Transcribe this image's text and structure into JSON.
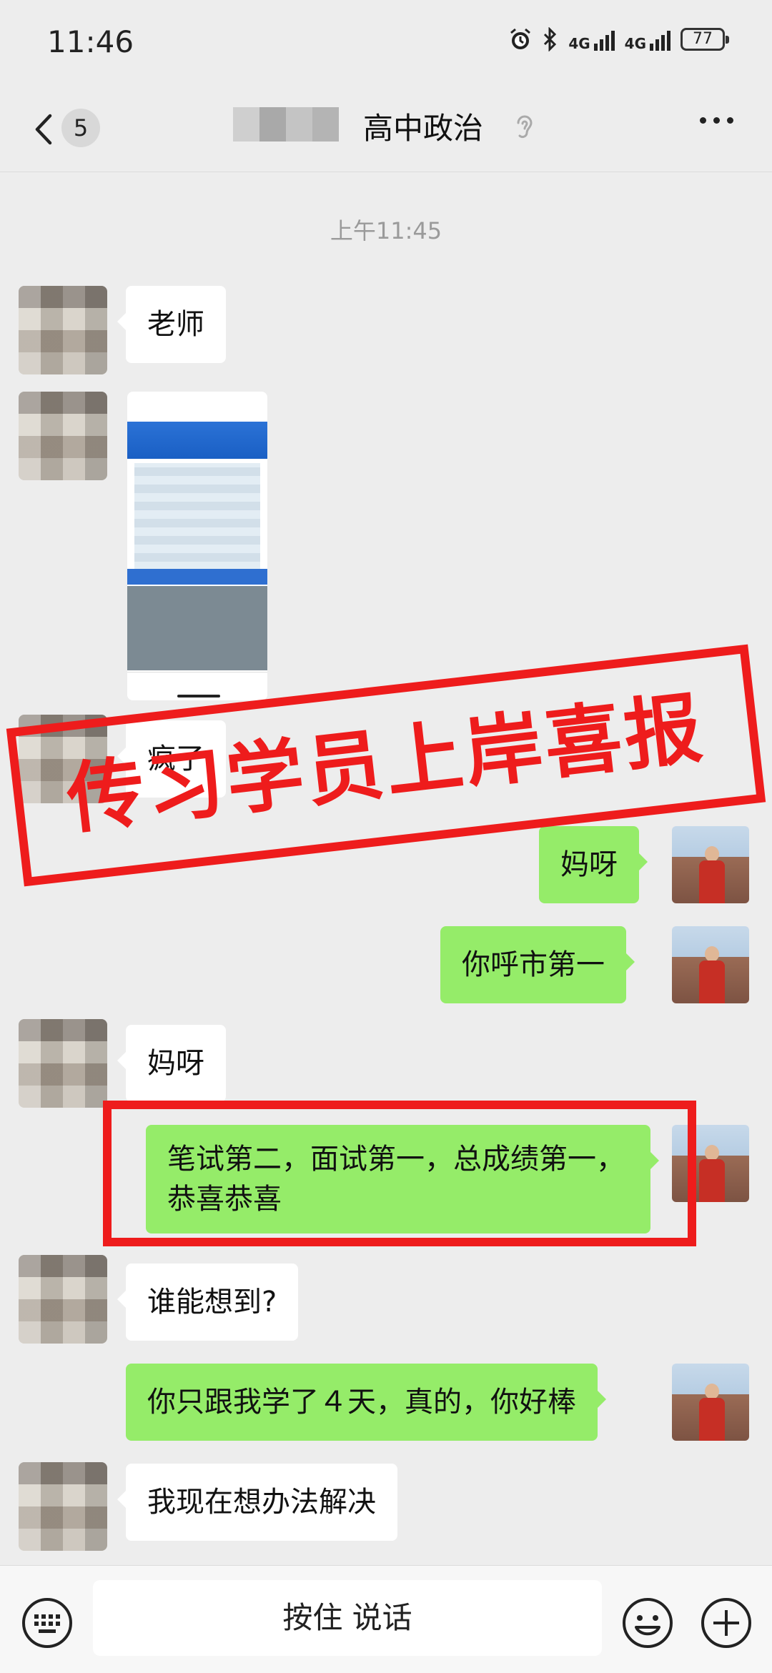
{
  "status_bar": {
    "time": "11:46",
    "network1": "4G",
    "network2": "4G",
    "battery": "77"
  },
  "nav": {
    "back_count": "5",
    "title": "高中政治",
    "icons": [
      "back-icon",
      "ear-icon",
      "more-icon"
    ]
  },
  "timestamp": "上午11:45",
  "messages": [
    {
      "side": "in",
      "text": "老师"
    },
    {
      "side": "in",
      "type": "image"
    },
    {
      "side": "in",
      "text": "疯了"
    },
    {
      "side": "out",
      "text": "妈呀"
    },
    {
      "side": "out",
      "text": "你呼市第一"
    },
    {
      "side": "in",
      "text": "妈呀"
    },
    {
      "side": "out",
      "text": "笔试第二，面试第一，总成绩第一，恭喜恭喜"
    },
    {
      "side": "in",
      "text": "谁能想到?"
    },
    {
      "side": "out",
      "text": "你只跟我学了４天，真的，你好棒"
    },
    {
      "side": "in",
      "text": "我现在想办法解决"
    }
  ],
  "stamp": {
    "text": "传习学员上岸喜报",
    "color": "#ee1c1c"
  },
  "input_bar": {
    "voice_label": "按住 说话",
    "icons": [
      "keyboard-icon",
      "emoji-icon",
      "plus-icon"
    ]
  },
  "colors": {
    "background": "#ededed",
    "outgoing_bubble": "#95ec69",
    "incoming_bubble": "#ffffff"
  }
}
